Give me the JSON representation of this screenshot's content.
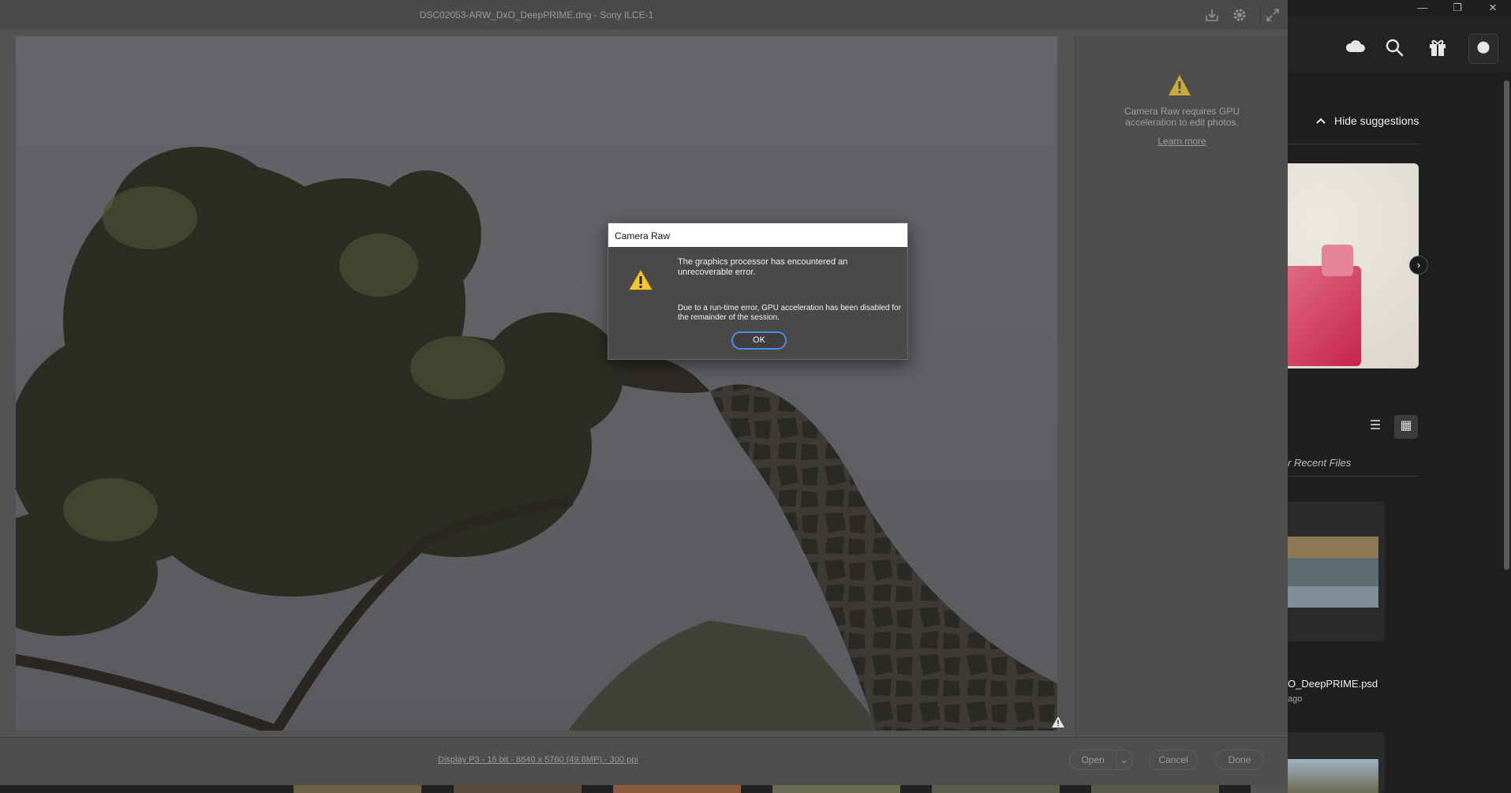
{
  "acr": {
    "title": "DSC02053-ARW_DxO_DeepPRIME.dng  -  Sony ILCE-1",
    "panel_message": "Camera Raw requires GPU acceleration to edit photos.",
    "panel_link": "Learn more",
    "workflow": "Display P3 - 16 bit - 8640 x 5760 (49.8MP) - 300 ppi",
    "open_label": "Open",
    "cancel_label": "Cancel",
    "done_label": "Done",
    "icons": [
      "save-icon",
      "settings-icon",
      "fullscreen-icon",
      "warning-icon"
    ]
  },
  "dialog": {
    "title": "Camera Raw",
    "message_primary": "The graphics processor has encountered an unrecoverable error.",
    "message_secondary": "Due to a run-time error, GPU acceleration has been disabled for the remainder of the session.",
    "ok_label": "OK"
  },
  "photoshop_home": {
    "window_controls": [
      "—",
      "❐",
      "✕"
    ],
    "hide_suggestions": "Hide suggestions",
    "recent_files_label": "r Recent Files",
    "recent_files": [
      {
        "name": "O_DeepPRIME.psd",
        "time": "ago"
      }
    ],
    "icons": [
      "cloud-icon",
      "search-icon",
      "gift-icon",
      "list-view-icon",
      "grid-view-icon"
    ]
  },
  "colors": {
    "acr_background": "#535353",
    "dialog_background": "#494949",
    "focus_ring": "#4a8fe7",
    "warning_yellow": "#e8c34a",
    "suggestion_pink": "#c7244a"
  }
}
